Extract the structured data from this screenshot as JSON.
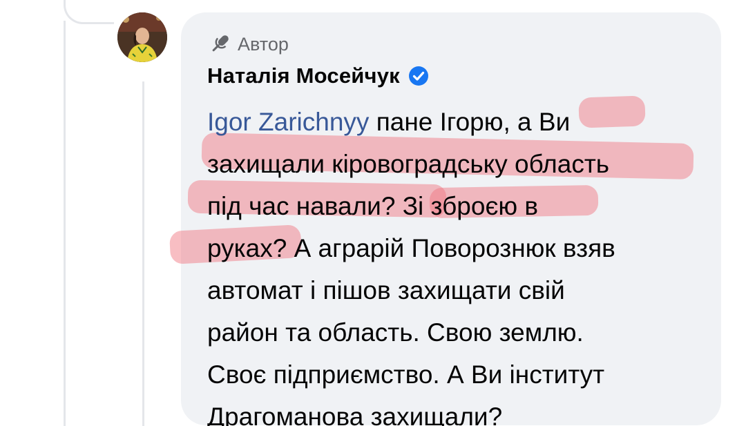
{
  "comment": {
    "author_badge": "Автор",
    "author_name": "Наталія Мосейчук",
    "mention": "Igor Zarichnyy",
    "lines": [
      " пане Ігорю, а Ви",
      "захищали кіровоградську область",
      "під час навали? Зі зброєю в",
      "руках? А аграрій Поворознюк взяв",
      "автомат і пішов захищати свій",
      "район та область. Свою землю.",
      "Своє підприємство. А Ви інститут",
      "Драгоманова захищали?"
    ],
    "icons": {
      "badge": "microphone-icon",
      "verified": "verified-badge-icon"
    }
  },
  "colors": {
    "bubble": "#f0f2f5",
    "mention": "#385898",
    "verified": "#1877f2",
    "highlight": "#f07882",
    "secondary_text": "#65676b"
  }
}
